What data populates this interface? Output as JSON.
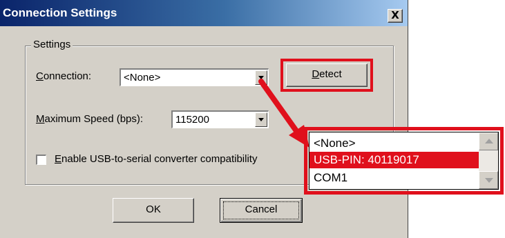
{
  "dialog": {
    "title": "Connection Settings",
    "close_label": "X"
  },
  "settings_group": {
    "label": "Settings",
    "connection": {
      "label_prefix": "",
      "label_underline": "C",
      "label_rest": "onnection:",
      "value": "<None>"
    },
    "detect_button": {
      "underline": "D",
      "rest": "etect"
    },
    "max_speed": {
      "label_underline": "M",
      "label_rest": "aximum Speed (bps):",
      "value": "115200"
    },
    "usb_checkbox": {
      "checked": false,
      "label_underline": "E",
      "label_rest": "nable USB-to-serial converter compatibility"
    }
  },
  "buttons": {
    "ok": "OK",
    "cancel": "Cancel"
  },
  "dropdown_callout": {
    "options": [
      "<None>",
      "USB-PIN: 40119017",
      "COM1"
    ],
    "selected_index": 1
  },
  "colors": {
    "highlight": "#e0101c",
    "dialog_bg": "#d4d0c8",
    "title_start": "#0a246a",
    "title_end": "#a6caf0"
  }
}
